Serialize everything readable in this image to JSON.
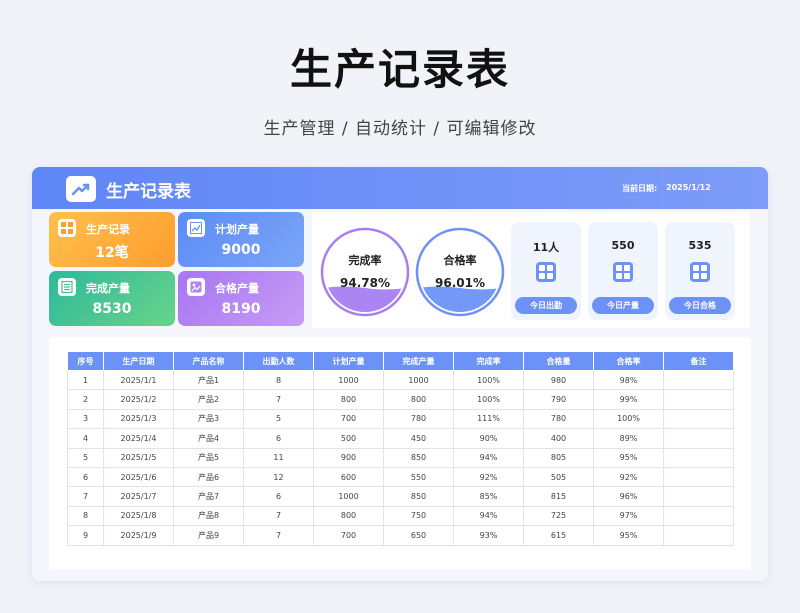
{
  "hero": {
    "title": "生产记录表",
    "subtitle": "生产管理 / 自动统计 / 可编辑修改"
  },
  "header": {
    "title": "生产记录表",
    "date_label": "当前日期:",
    "date_value": "2025/1/12"
  },
  "stats": [
    {
      "label": "生产记录",
      "value": "12笔",
      "icon": "grid-icon"
    },
    {
      "label": "计划产量",
      "value": "9000",
      "icon": "trend-chart-icon"
    },
    {
      "label": "完成产量",
      "value": "8530",
      "icon": "document-list-icon"
    },
    {
      "label": "合格产量",
      "value": "8190",
      "icon": "image-badge-icon"
    }
  ],
  "gauges": [
    {
      "label": "完成率",
      "value": "94.78%",
      "fraction": 0.9478
    },
    {
      "label": "合格率",
      "value": "96.01%",
      "fraction": 0.9601
    }
  ],
  "mini_cards": [
    {
      "value": "11人",
      "button": "今日出勤",
      "icon": "grid-icon"
    },
    {
      "value": "550",
      "button": "今日产量",
      "icon": "grid-icon"
    },
    {
      "value": "535",
      "button": "今日合格",
      "icon": "grid-icon"
    }
  ],
  "table": {
    "headers": [
      "序号",
      "生产日期",
      "产品名称",
      "出勤人数",
      "计划产量",
      "完成产量",
      "完成率",
      "合格量",
      "合格率",
      "备注"
    ],
    "rows": [
      [
        "1",
        "2025/1/1",
        "产品1",
        "8",
        "1000",
        "1000",
        "100%",
        "980",
        "98%",
        ""
      ],
      [
        "2",
        "2025/1/2",
        "产品2",
        "7",
        "800",
        "800",
        "100%",
        "790",
        "99%",
        ""
      ],
      [
        "3",
        "2025/1/3",
        "产品3",
        "5",
        "700",
        "780",
        "111%",
        "780",
        "100%",
        ""
      ],
      [
        "4",
        "2025/1/4",
        "产品4",
        "6",
        "500",
        "450",
        "90%",
        "400",
        "89%",
        ""
      ],
      [
        "5",
        "2025/1/5",
        "产品5",
        "11",
        "900",
        "850",
        "94%",
        "805",
        "95%",
        ""
      ],
      [
        "6",
        "2025/1/6",
        "产品6",
        "12",
        "600",
        "550",
        "92%",
        "505",
        "92%",
        ""
      ],
      [
        "7",
        "2025/1/7",
        "产品7",
        "6",
        "1000",
        "850",
        "85%",
        "815",
        "96%",
        ""
      ],
      [
        "8",
        "2025/1/8",
        "产品8",
        "7",
        "800",
        "750",
        "94%",
        "725",
        "97%",
        ""
      ],
      [
        "9",
        "2025/1/9",
        "产品9",
        "7",
        "700",
        "650",
        "93%",
        "615",
        "95%",
        ""
      ]
    ]
  },
  "colors": {
    "header_gradient_start": "#5f86f6",
    "header_gradient_end": "#7e9cf8",
    "accent": "#6d92f7",
    "card_orange": "#fdae3b",
    "card_blue": "#6a95f5",
    "card_green": "#3fc28e",
    "card_purple": "#b184f3",
    "gauge_purple": "#a77ef2",
    "gauge_blue": "#6d92f7"
  }
}
